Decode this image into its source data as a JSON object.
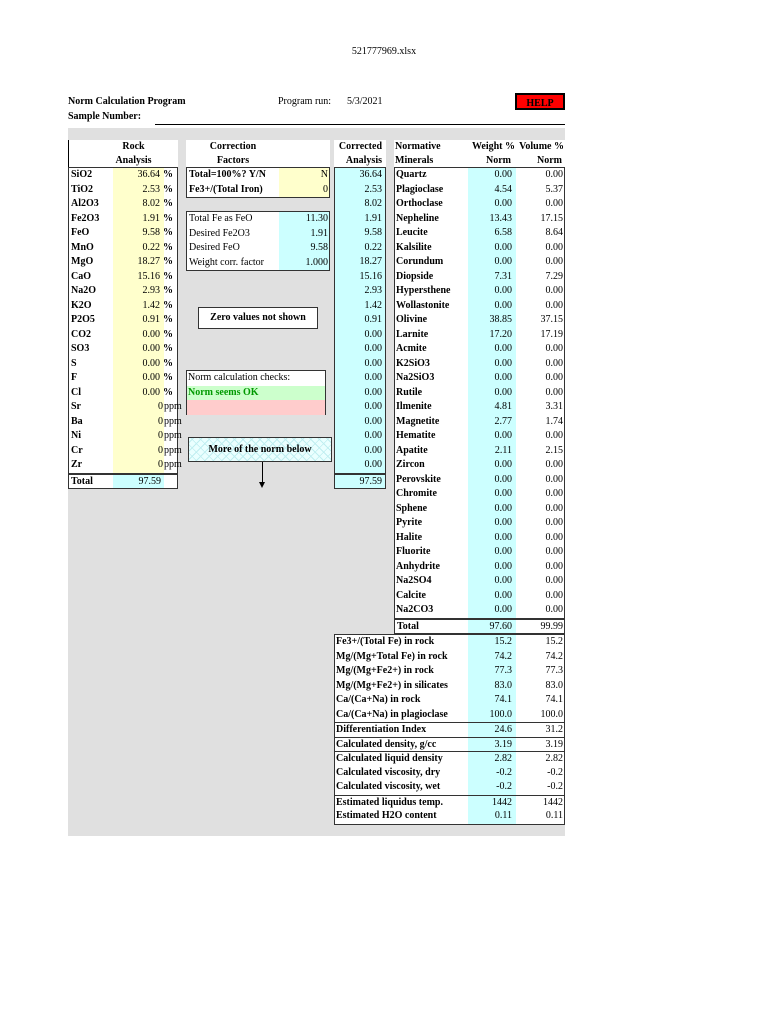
{
  "file_title": "521777969.xlsx",
  "header": {
    "program_title": "Norm Calculation Program",
    "sample_label": "Sample Number:",
    "program_run_label": "Program run:",
    "program_run_date": "5/3/2021",
    "help_button": "HELP"
  },
  "rock": {
    "h1": "Rock",
    "h2": "Analysis",
    "rows": [
      {
        "n": "SiO2",
        "v": "36.64",
        "u": "%"
      },
      {
        "n": "TiO2",
        "v": "2.53",
        "u": "%"
      },
      {
        "n": "Al2O3",
        "v": "8.02",
        "u": "%"
      },
      {
        "n": "Fe2O3",
        "v": "1.91",
        "u": "%"
      },
      {
        "n": "FeO",
        "v": "9.58",
        "u": "%"
      },
      {
        "n": "MnO",
        "v": "0.22",
        "u": "%"
      },
      {
        "n": "MgO",
        "v": "18.27",
        "u": "%"
      },
      {
        "n": "CaO",
        "v": "15.16",
        "u": "%"
      },
      {
        "n": "Na2O",
        "v": "2.93",
        "u": "%"
      },
      {
        "n": "K2O",
        "v": "1.42",
        "u": "%"
      },
      {
        "n": "P2O5",
        "v": "0.91",
        "u": "%"
      },
      {
        "n": "CO2",
        "v": "0.00",
        "u": "%"
      },
      {
        "n": "SO3",
        "v": "0.00",
        "u": "%"
      },
      {
        "n": "S",
        "v": "0.00",
        "u": "%"
      },
      {
        "n": "F",
        "v": "0.00",
        "u": "%"
      },
      {
        "n": "Cl",
        "v": "0.00",
        "u": "%"
      },
      {
        "n": "Sr",
        "v": "0",
        "u": "ppm"
      },
      {
        "n": "Ba",
        "v": "0",
        "u": "ppm"
      },
      {
        "n": "Ni",
        "v": "0",
        "u": "ppm"
      },
      {
        "n": "Cr",
        "v": "0",
        "u": "ppm"
      },
      {
        "n": "Zr",
        "v": "0",
        "u": "ppm"
      }
    ],
    "total_label": "Total",
    "total": "97.59"
  },
  "correction": {
    "h1": "Correction",
    "h2": "Factors",
    "inputs": [
      {
        "n": "Total=100%? Y/N",
        "v": "N"
      },
      {
        "n": "Fe3+/(Total Iron)",
        "v": "0"
      }
    ],
    "calc": [
      {
        "n": "Total Fe as FeO",
        "v": "11.30"
      },
      {
        "n": "Desired Fe2O3",
        "v": "1.91"
      },
      {
        "n": "Desired FeO",
        "v": "9.58"
      },
      {
        "n": "Weight corr. factor",
        "v": "1.000"
      }
    ]
  },
  "notes": {
    "zero": "Zero values not shown",
    "checks_title": "Norm calculation checks:",
    "checks_status": "Norm seems OK",
    "more": "More of the norm below"
  },
  "corrected": {
    "h1": "Corrected",
    "h2": "Analysis",
    "values": [
      "36.64",
      "2.53",
      "8.02",
      "1.91",
      "9.58",
      "0.22",
      "18.27",
      "15.16",
      "2.93",
      "1.42",
      "0.91",
      "0.00",
      "0.00",
      "0.00",
      "0.00",
      "0.00",
      "0.00",
      "0.00",
      "0.00",
      "0.00",
      "0.00"
    ],
    "total": "97.59"
  },
  "norm": {
    "h1": "Normative",
    "h2": "Minerals",
    "w1": "Weight %",
    "w2": "Norm",
    "v1": "Volume %",
    "v2": "Norm",
    "rows": [
      {
        "n": "Quartz",
        "w": "0.00",
        "v": "0.00"
      },
      {
        "n": "Plagioclase",
        "w": "4.54",
        "v": "5.37"
      },
      {
        "n": "Orthoclase",
        "w": "0.00",
        "v": "0.00"
      },
      {
        "n": "Nepheline",
        "w": "13.43",
        "v": "17.15"
      },
      {
        "n": "Leucite",
        "w": "6.58",
        "v": "8.64"
      },
      {
        "n": "Kalsilite",
        "w": "0.00",
        "v": "0.00"
      },
      {
        "n": "Corundum",
        "w": "0.00",
        "v": "0.00"
      },
      {
        "n": "Diopside",
        "w": "7.31",
        "v": "7.29"
      },
      {
        "n": "Hypersthene",
        "w": "0.00",
        "v": "0.00"
      },
      {
        "n": "Wollastonite",
        "w": "0.00",
        "v": "0.00"
      },
      {
        "n": "Olivine",
        "w": "38.85",
        "v": "37.15"
      },
      {
        "n": "Larnite",
        "w": "17.20",
        "v": "17.19"
      },
      {
        "n": "Acmite",
        "w": "0.00",
        "v": "0.00"
      },
      {
        "n": "K2SiO3",
        "w": "0.00",
        "v": "0.00"
      },
      {
        "n": "Na2SiO3",
        "w": "0.00",
        "v": "0.00"
      },
      {
        "n": "Rutile",
        "w": "0.00",
        "v": "0.00"
      },
      {
        "n": "Ilmenite",
        "w": "4.81",
        "v": "3.31"
      },
      {
        "n": "Magnetite",
        "w": "2.77",
        "v": "1.74"
      },
      {
        "n": "Hematite",
        "w": "0.00",
        "v": "0.00"
      },
      {
        "n": "Apatite",
        "w": "2.11",
        "v": "2.15"
      },
      {
        "n": "Zircon",
        "w": "0.00",
        "v": "0.00"
      },
      {
        "n": "Perovskite",
        "w": "0.00",
        "v": "0.00"
      },
      {
        "n": "Chromite",
        "w": "0.00",
        "v": "0.00"
      },
      {
        "n": "Sphene",
        "w": "0.00",
        "v": "0.00"
      },
      {
        "n": "Pyrite",
        "w": "0.00",
        "v": "0.00"
      },
      {
        "n": "Halite",
        "w": "0.00",
        "v": "0.00"
      },
      {
        "n": "Fluorite",
        "w": "0.00",
        "v": "0.00"
      },
      {
        "n": "Anhydrite",
        "w": "0.00",
        "v": "0.00"
      },
      {
        "n": "Na2SO4",
        "w": "0.00",
        "v": "0.00"
      },
      {
        "n": "Calcite",
        "w": "0.00",
        "v": "0.00"
      },
      {
        "n": "Na2CO3",
        "w": "0.00",
        "v": "0.00"
      }
    ],
    "total_label": "Total",
    "total_w": "97.60",
    "total_v": "99.99"
  },
  "stats": [
    {
      "n": "Fe3+/(Total Fe) in rock",
      "w": "15.2",
      "v": "15.2",
      "g": 0
    },
    {
      "n": "Mg/(Mg+Total Fe) in rock",
      "w": "74.2",
      "v": "74.2",
      "g": 0
    },
    {
      "n": "Mg/(Mg+Fe2+) in rock",
      "w": "77.3",
      "v": "77.3",
      "g": 0
    },
    {
      "n": "Mg/(Mg+Fe2+) in silicates",
      "w": "83.0",
      "v": "83.0",
      "g": 0
    },
    {
      "n": "Ca/(Ca+Na) in rock",
      "w": "74.1",
      "v": "74.1",
      "g": 0
    },
    {
      "n": "Ca/(Ca+Na) in plagioclase",
      "w": "100.0",
      "v": "100.0",
      "g": 0
    },
    {
      "n": "Differentiation Index",
      "w": "24.6",
      "v": "31.2",
      "g": 1
    },
    {
      "n": "Calculated density, g/cc",
      "w": "3.19",
      "v": "3.19",
      "g": 1
    },
    {
      "n": "Calculated liquid density",
      "w": "2.82",
      "v": "2.82",
      "g": 1
    },
    {
      "n": "Calculated viscosity, dry",
      "w": "-0.2",
      "v": "-0.2",
      "g": 0
    },
    {
      "n": "Calculated viscosity, wet",
      "w": "-0.2",
      "v": "-0.2",
      "g": 0
    },
    {
      "n": "Estimated liquidus temp.",
      "w": "1442",
      "v": "1442",
      "g": 1
    },
    {
      "n": "Estimated H2O content",
      "w": "0.11",
      "v": "0.11",
      "g": 0
    }
  ],
  "colors": {
    "input": "#ffffcc",
    "calc": "#ccffff",
    "ok": "#ccffcc",
    "warn": "#ffcccc",
    "help": "#ff0000"
  }
}
